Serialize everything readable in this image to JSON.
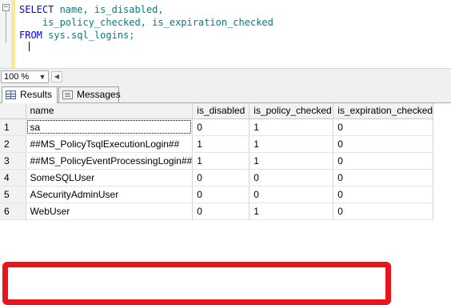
{
  "editor": {
    "lines": [
      [
        {
          "t": "SELECT",
          "c": "kw"
        },
        {
          "t": " name, is_disabled,",
          "c": "tk"
        }
      ],
      [
        {
          "t": "    is_policy_checked, is_expiration_checked",
          "c": "tk"
        }
      ],
      [
        {
          "t": "FROM",
          "c": "kw"
        },
        {
          "t": " sys.sql_logins;",
          "c": "tk"
        }
      ]
    ]
  },
  "zoom": {
    "value": "100 %"
  },
  "tabs": {
    "results_label": "Results",
    "messages_label": "Messages"
  },
  "grid": {
    "columns": [
      "",
      "name",
      "is_disabled",
      "is_policy_checked",
      "is_expiration_checked"
    ],
    "rows": [
      [
        "1",
        "sa",
        "0",
        "1",
        "0"
      ],
      [
        "2",
        "##MS_PolicyTsqlExecutionLogin##",
        "1",
        "1",
        "0"
      ],
      [
        "3",
        "##MS_PolicyEventProcessingLogin##",
        "1",
        "1",
        "0"
      ],
      [
        "4",
        "SomeSQLUser",
        "0",
        "0",
        "0"
      ],
      [
        "5",
        "ASecurityAdminUser",
        "0",
        "0",
        "0"
      ],
      [
        "6",
        "WebUser",
        "0",
        "1",
        "0"
      ]
    ]
  },
  "colors": {
    "highlight": "#e8151b",
    "keyword": "#0000ff",
    "identifier": "#008080"
  }
}
